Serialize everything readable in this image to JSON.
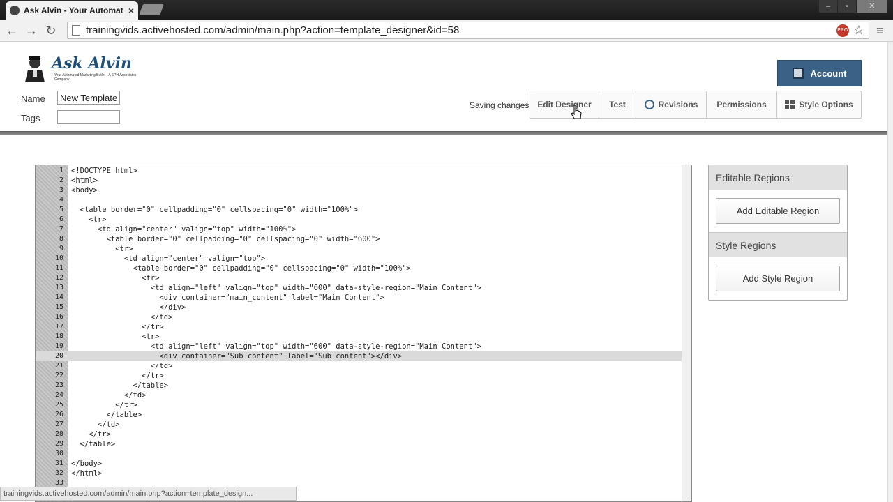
{
  "browser": {
    "tab_title": "Ask Alvin - Your Automat",
    "tab_close": "×",
    "url": "trainingvids.activehosted.com/admin/main.php?action=template_designer&id=58",
    "pro_badge": "PRO",
    "status_url": "trainingvids.activehosted.com/admin/main.php?action=template_design..."
  },
  "logo": {
    "text": "Ask Alvin",
    "subtitle": "Your Automated Marketing Butler · A SPH Associates Company"
  },
  "form": {
    "name_label": "Name",
    "name_value": "New Template",
    "tags_label": "Tags",
    "tags_value": ""
  },
  "header": {
    "saving_text": "Saving changes",
    "account_label": "Account",
    "buttons": {
      "edit_designer": "Edit Designer",
      "test": "Test",
      "revisions": "Revisions",
      "permissions": "Permissions",
      "style_options": "Style Options"
    }
  },
  "editor": {
    "active_line": 20,
    "lines": [
      "<!DOCTYPE html>",
      "<html>",
      "<body>",
      "",
      "  <table border=\"0\" cellpadding=\"0\" cellspacing=\"0\" width=\"100%\">",
      "    <tr>",
      "      <td align=\"center\" valign=\"top\" width=\"100%\">",
      "        <table border=\"0\" cellpadding=\"0\" cellspacing=\"0\" width=\"600\">",
      "          <tr>",
      "            <td align=\"center\" valign=\"top\">",
      "              <table border=\"0\" cellpadding=\"0\" cellspacing=\"0\" width=\"100%\">",
      "                <tr>",
      "                  <td align=\"left\" valign=\"top\" width=\"600\" data-style-region=\"Main Content\">",
      "                    <div container=\"main_content\" label=\"Main Content\">",
      "                    </div>",
      "                  </td>",
      "                </tr>",
      "                <tr>",
      "                  <td align=\"left\" valign=\"top\" width=\"600\" data-style-region=\"Main Content\">",
      "                    <div container=\"Sub content\" label=\"Sub content\"></div>",
      "                  </td>",
      "                </tr>",
      "              </table>",
      "            </td>",
      "          </tr>",
      "        </table>",
      "      </td>",
      "    </tr>",
      "  </table>",
      "",
      "</body>",
      "</html>",
      ""
    ]
  },
  "panel": {
    "editable_title": "Editable Regions",
    "add_editable": "Add Editable Region",
    "style_title": "Style Regions",
    "add_style": "Add Style Region"
  }
}
